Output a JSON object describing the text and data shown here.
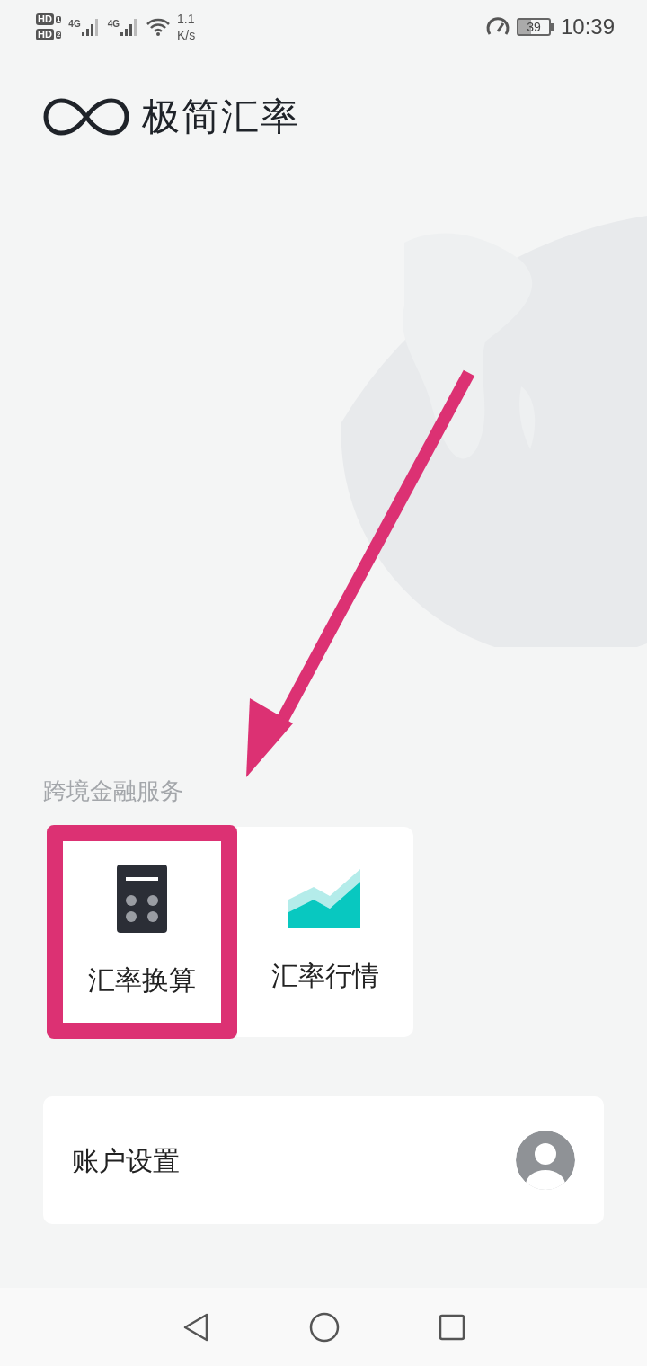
{
  "status_bar": {
    "sims": [
      {
        "badge": "HD",
        "slot": "1"
      },
      {
        "badge": "HD",
        "slot": "2"
      }
    ],
    "networks": [
      "4G",
      "4G"
    ],
    "speed": "1.1",
    "speed_unit": "K/s",
    "battery": "39",
    "time": "10:39"
  },
  "app": {
    "title": "极简汇率"
  },
  "section": {
    "title": "跨境金融服务",
    "tiles": [
      {
        "kind": "calculator",
        "label": "汇率换算",
        "highlighted": true
      },
      {
        "kind": "chart",
        "label": "汇率行情",
        "highlighted": false
      }
    ]
  },
  "account": {
    "label": "账户设置"
  }
}
